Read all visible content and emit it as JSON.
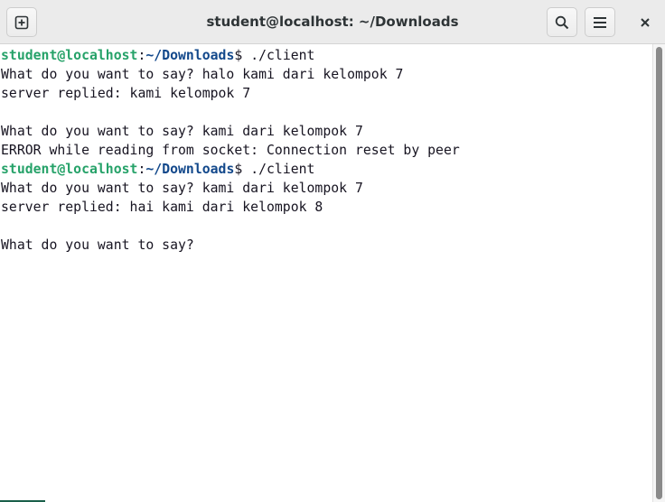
{
  "window": {
    "title": "student@localhost: ~/Downloads"
  },
  "icons": {
    "new_tab": "new-tab-icon",
    "search": "search-icon",
    "menu": "hamburger-menu-icon",
    "close": "close-icon"
  },
  "colors": {
    "prompt_user": "#26a269",
    "prompt_path": "#12488b",
    "text": "#171421",
    "titlebar_bg": "#ebebeb"
  },
  "terminal": {
    "lines": [
      {
        "type": "prompt",
        "user": "student@localhost",
        "sep": ":",
        "path": "~/Downloads",
        "suffix": "$ ./client"
      },
      {
        "type": "text",
        "text": "What do you want to say? halo kami dari kelompok 7"
      },
      {
        "type": "text",
        "text": "server replied: kami kelompok 7"
      },
      {
        "type": "text",
        "text": ""
      },
      {
        "type": "text",
        "text": "What do you want to say? kami dari kelompok 7"
      },
      {
        "type": "text",
        "text": "ERROR while reading from socket: Connection reset by peer"
      },
      {
        "type": "prompt",
        "user": "student@localhost",
        "sep": ":",
        "path": "~/Downloads",
        "suffix": "$ ./client"
      },
      {
        "type": "text",
        "text": "What do you want to say? kami dari kelompok 7"
      },
      {
        "type": "text",
        "text": "server replied: hai kami dari kelompok 8"
      },
      {
        "type": "text",
        "text": ""
      },
      {
        "type": "text",
        "text": "What do you want to say? "
      }
    ]
  }
}
